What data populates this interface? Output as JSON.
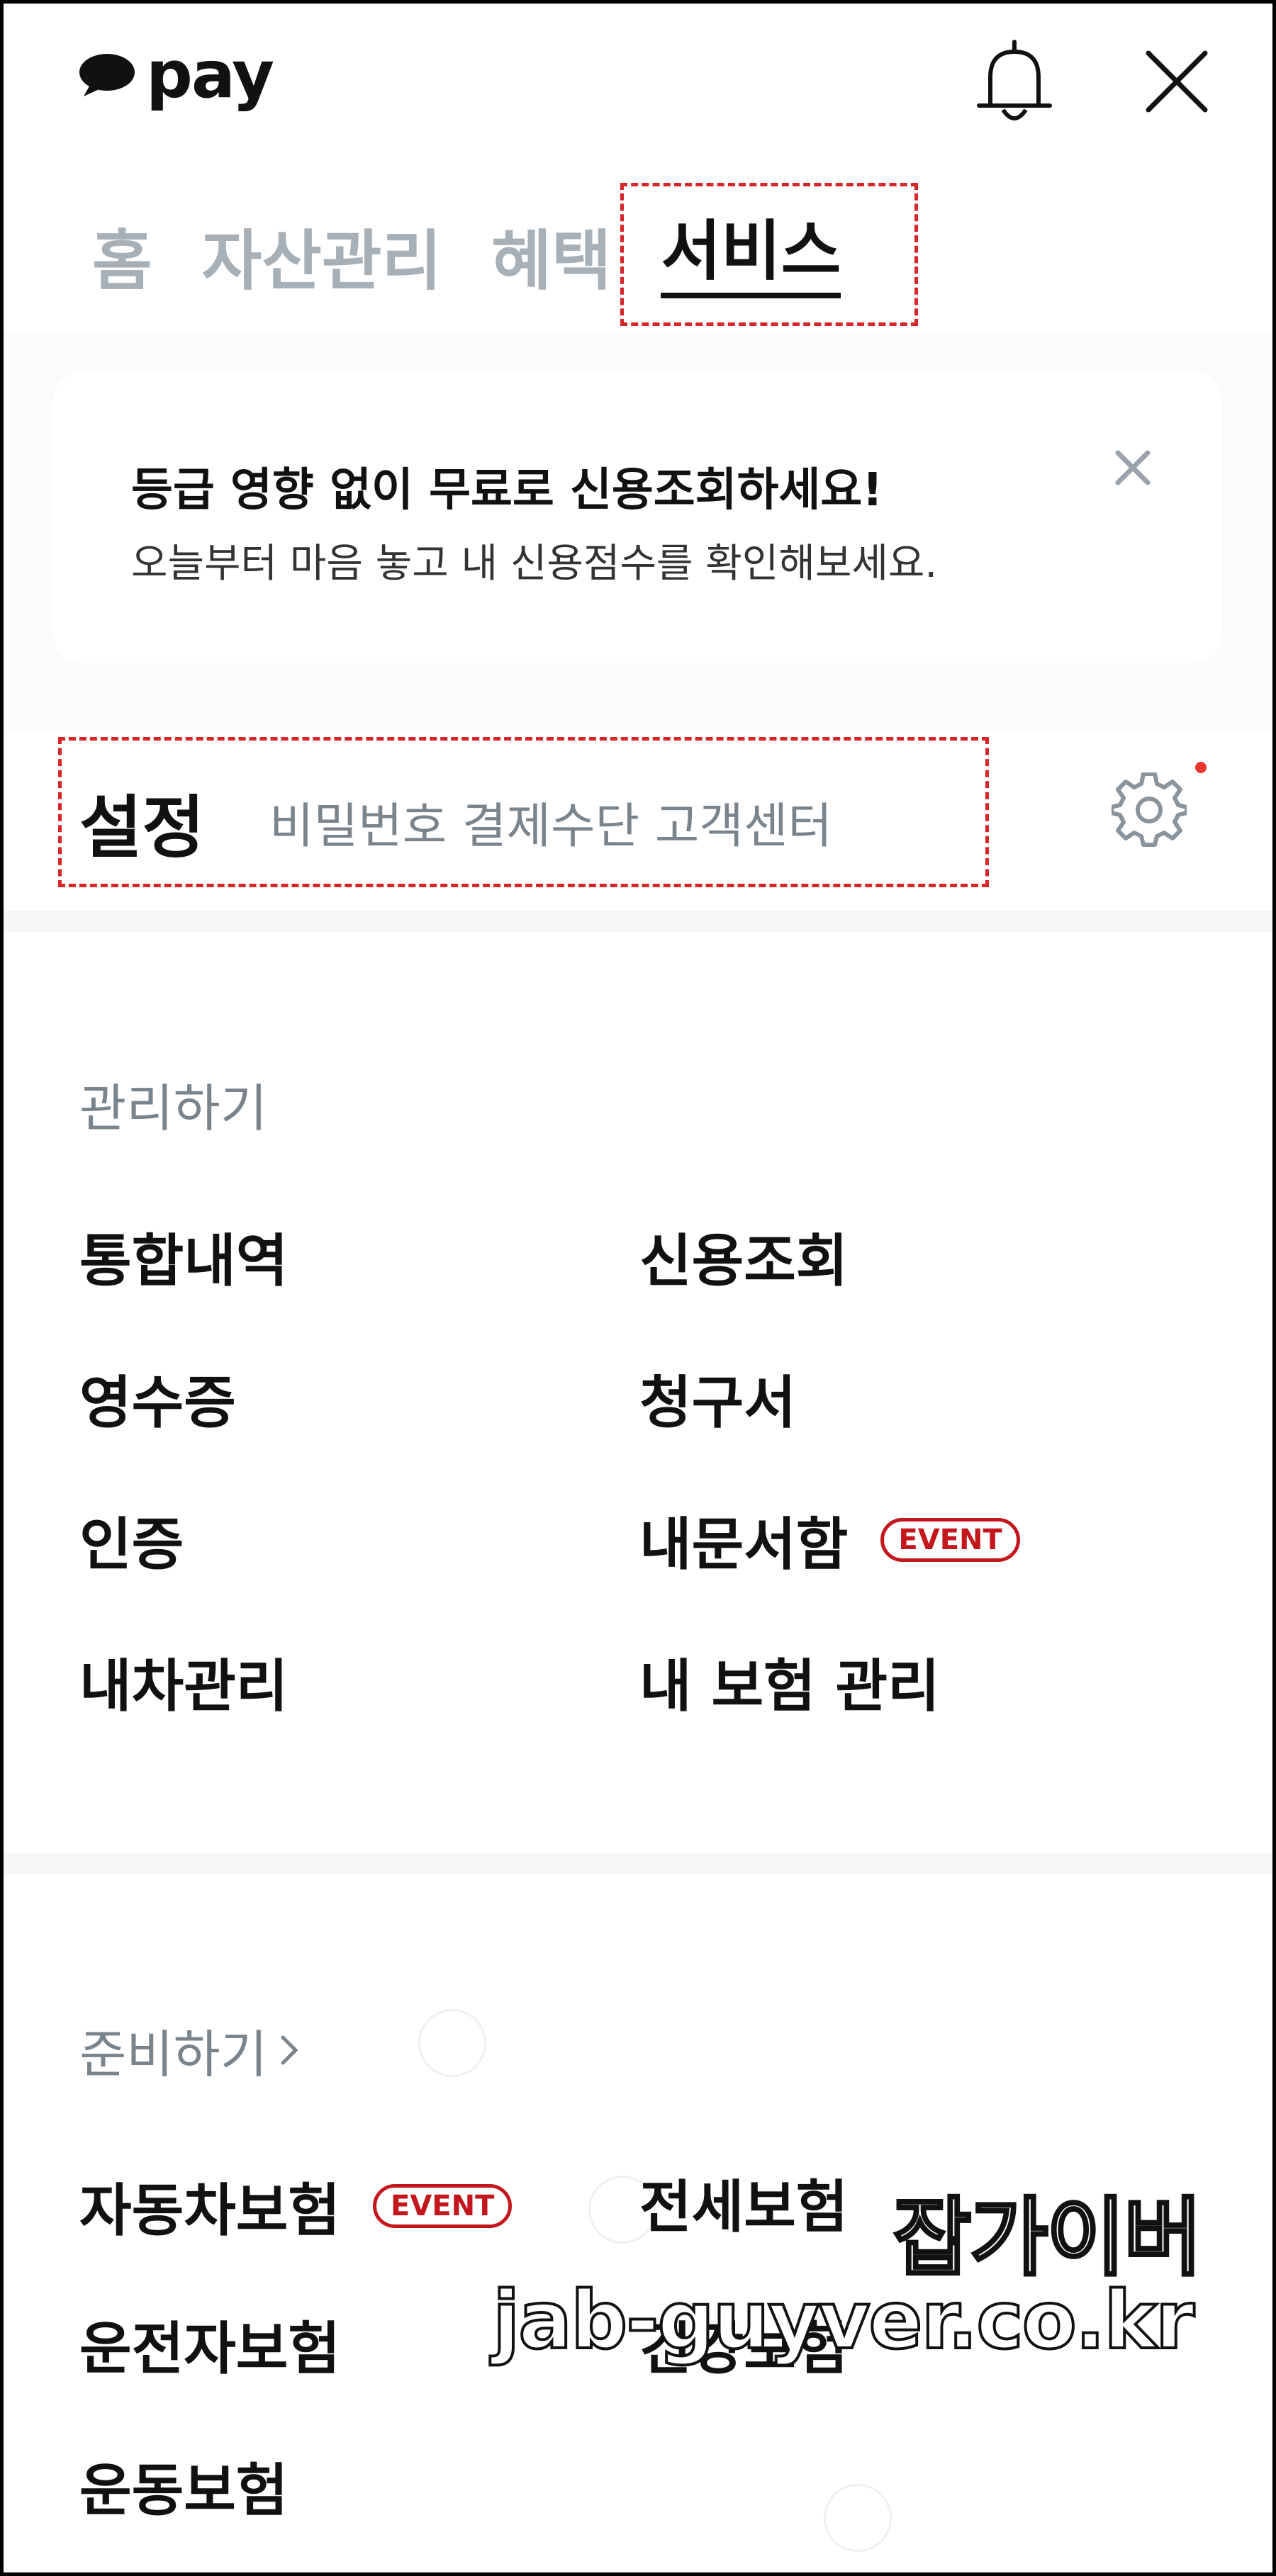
{
  "header": {
    "logo_text": "pay",
    "logo_icon": "speech-bubble-icon",
    "bell_icon": "bell-icon",
    "close_icon": "close-icon"
  },
  "tabs": [
    {
      "label": "홈",
      "active": false
    },
    {
      "label": "자산관리",
      "active": false
    },
    {
      "label": "혜택",
      "active": false
    },
    {
      "label": "서비스",
      "active": true
    }
  ],
  "banner": {
    "title": "등급 영향 없이 무료로 신용조회하세요!",
    "subtitle": "오늘부터 마음 놓고 내 신용점수를 확인해보세요.",
    "close_icon": "close-icon"
  },
  "settings": {
    "title": "설정",
    "subtitle": "비밀번호 결제수단 고객센터",
    "icon": "gear-icon",
    "dot_color": "#e8352e"
  },
  "manage": {
    "label": "관리하기",
    "items": [
      {
        "label": "통합내역"
      },
      {
        "label": "신용조회"
      },
      {
        "label": "영수증"
      },
      {
        "label": "청구서"
      },
      {
        "label": "인증"
      },
      {
        "label": "내문서함",
        "badge": "EVENT"
      },
      {
        "label": "내차관리"
      },
      {
        "label": "내 보험 관리"
      }
    ]
  },
  "prepare": {
    "label": "준비하기",
    "chevron_icon": "chevron-right-icon",
    "items": [
      {
        "label": "자동차보험",
        "badge": "EVENT"
      },
      {
        "label": "전세보험"
      },
      {
        "label": "운전자보험"
      },
      {
        "label": "건강보험"
      },
      {
        "label": "운동보험"
      }
    ]
  },
  "watermark": {
    "line1": "잡가이버",
    "line2": "jab-guyver.co.kr"
  },
  "colors": {
    "accent_red": "#c4171d",
    "highlight_dash": "#d6262a",
    "muted_text": "#7a848c",
    "inactive_tab": "#a7b0b7"
  }
}
